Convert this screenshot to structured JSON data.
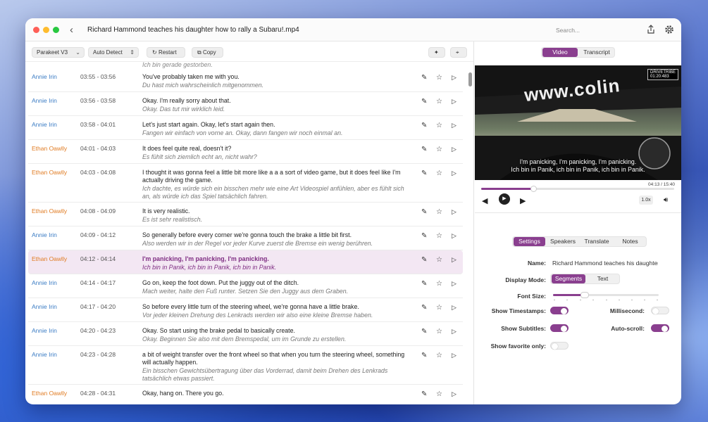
{
  "window": {
    "title": "Richard Hammond teaches his daughter how to rally a Subaru!.mp4",
    "search_placeholder": "Search..."
  },
  "toolbar": {
    "model": "Parakeet V3",
    "language": "Auto Detect",
    "restart": "Restart",
    "copy": "Copy"
  },
  "colors": {
    "accent": "#8a3f8f",
    "speaker_annie": "#3b7cc4",
    "speaker_ethan": "#e07b22"
  },
  "partial_top": "Ich bin gerade gestorben.",
  "segments": [
    {
      "speaker": "Annie Irin",
      "time": "03:55 - 03:56",
      "text": "You've probably taken me with you.",
      "translation": "Du hast mich wahrscheinlich mitgenommen."
    },
    {
      "speaker": "Annie Irin",
      "time": "03:56 - 03:58",
      "text": "Okay. I'm really sorry about that.",
      "translation": "Okay. Das tut mir wirklich leid."
    },
    {
      "speaker": "Annie Irin",
      "time": "03:58 - 04:01",
      "text": "Let's just start again. Okay, let's start again then.",
      "translation": "Fangen wir einfach von vorne an. Okay, dann fangen wir noch einmal an."
    },
    {
      "speaker": "Ethan Oawlly",
      "time": "04:01 - 04:03",
      "text": "It does feel quite real, doesn't it?",
      "translation": "Es fühlt sich ziemlich echt an, nicht wahr?"
    },
    {
      "speaker": "Ethan Oawlly",
      "time": "04:03 - 04:08",
      "text": "I thought it was gonna feel a little bit more like a a a sort of video game, but it does feel like I'm actually driving the game.",
      "translation": "Ich dachte, es würde sich ein bisschen mehr wie eine Art Videospiel anfühlen, aber es fühlt sich an, als würde ich das Spiel tatsächlich fahren."
    },
    {
      "speaker": "Ethan Oawlly",
      "time": "04:08 - 04:09",
      "text": "It is very realistic.",
      "translation": "Es ist sehr realistisch."
    },
    {
      "speaker": "Annie Irin",
      "time": "04:09 - 04:12",
      "text": "So generally before every corner we're gonna touch the brake a little bit first.",
      "translation": "Also werden wir in der Regel vor jeder Kurve zuerst die Bremse ein wenig berühren."
    },
    {
      "speaker": "Ethan Oawlly",
      "time": "04:12 - 04:14",
      "text": "I'm panicking, I'm panicking, I'm panicking.",
      "translation": "Ich bin in Panik, ich bin in Panik, ich bin in Panik."
    },
    {
      "speaker": "Annie Irin",
      "time": "04:14 - 04:17",
      "text": "Go on, keep the foot down. Put the juggy out of the ditch.",
      "translation": "Mach weiter, halte den Fuß runter. Setzen Sie den Juggy aus dem Graben."
    },
    {
      "speaker": "Annie Irin",
      "time": "04:17 - 04:20",
      "text": "So before every little turn of the steering wheel, we're gonna have a little brake.",
      "translation": "Vor jeder kleinen Drehung des Lenkrads werden wir also eine kleine Bremse haben."
    },
    {
      "speaker": "Annie Irin",
      "time": "04:20 - 04:23",
      "text": "Okay. So start using the brake pedal to basically create.",
      "translation": "Okay. Beginnen Sie also mit dem Bremspedal, um im Grunde zu erstellen."
    },
    {
      "speaker": "Annie Irin",
      "time": "04:23 - 04:28",
      "text": "a bit of weight transfer over the front wheel so that when you turn the steering wheel, something will actually happen.",
      "translation": "Ein bisschen Gewichtsübertragung über das Vorderrad, damit beim Drehen des Lenkrads tatsächlich etwas passiert."
    },
    {
      "speaker": "Ethan Oawlly",
      "time": "04:28 - 04:31",
      "text": "Okay, hang on. There you go.",
      "translation": ""
    }
  ],
  "view_tabs": [
    "Video",
    "Transcript"
  ],
  "video": {
    "subtitle_en": "I'm panicking, I'm panicking, I'm panicking.",
    "subtitle_de": "Ich bin in Panik, ich bin in Panik, ich bin in Panik.",
    "watermark": "DRIVETRIBE",
    "watermark_time": "01:20:483",
    "overlay_text": "www.colin",
    "time": "04:13 / 15:40",
    "rate": "1.0x",
    "progress": 0.27
  },
  "settings_tabs": [
    "Settings",
    "Speakers",
    "Translate",
    "Notes"
  ],
  "settings": {
    "name_label": "Name:",
    "name_value": "Richard Hammond teaches his daughter",
    "display_mode_label": "Display Mode:",
    "display_modes": [
      "Segments",
      "Text"
    ],
    "font_size_label": "Font Size:",
    "font_size": 0.3,
    "show_timestamps_label": "Show Timestamps:",
    "show_timestamps": true,
    "millisecond_label": "Millisecond:",
    "millisecond": false,
    "show_subtitles_label": "Show Subtitles:",
    "show_subtitles": true,
    "auto_scroll_label": "Auto-scroll:",
    "auto_scroll": true,
    "show_favorite_label": "Show favorite only:",
    "show_favorite": false
  }
}
